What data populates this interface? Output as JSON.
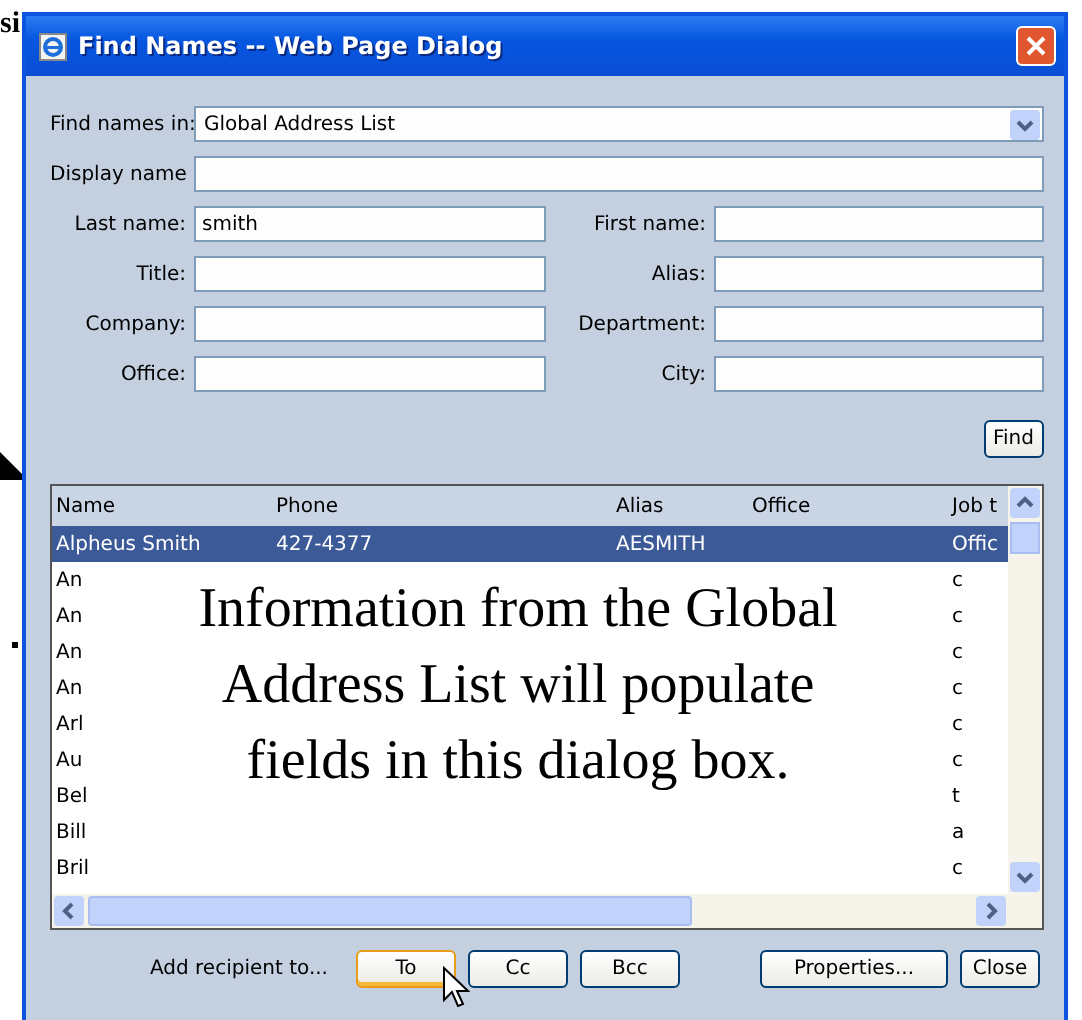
{
  "slide_text": "si",
  "window": {
    "title": "Find Names -- Web Page Dialog"
  },
  "find_in": {
    "label": "Find names in:",
    "value": "Global Address List"
  },
  "display_name": {
    "label": "Display name"
  },
  "fields": [
    {
      "label": "Last name:",
      "value": "smith"
    },
    {
      "label": "First name:"
    },
    {
      "label": "Title:"
    },
    {
      "label": "Alias:"
    },
    {
      "label": "Company:"
    },
    {
      "label": "Department:"
    },
    {
      "label": "Office:"
    },
    {
      "label": "City:"
    }
  ],
  "find_button": "Find",
  "table": {
    "columns": [
      "Name",
      "Phone",
      "Alias",
      "Office",
      "Job t"
    ],
    "rows": [
      {
        "cells": [
          "Alpheus Smith",
          "427-4377",
          "AESMITH",
          "",
          "Offic"
        ],
        "selected": true
      },
      {
        "cells": [
          "An",
          "",
          "",
          "",
          "c"
        ],
        "selected": false
      },
      {
        "cells": [
          "An",
          "",
          "",
          "",
          "c"
        ],
        "selected": false
      },
      {
        "cells": [
          "An",
          "",
          "",
          "",
          "c"
        ],
        "selected": false
      },
      {
        "cells": [
          "An",
          "",
          "",
          "",
          "c"
        ],
        "selected": false
      },
      {
        "cells": [
          "Arl",
          "",
          "",
          "",
          "c"
        ],
        "selected": false
      },
      {
        "cells": [
          "Au",
          "",
          "",
          "",
          "c"
        ],
        "selected": false
      },
      {
        "cells": [
          "Bel",
          "",
          "",
          "",
          "t"
        ],
        "selected": false
      },
      {
        "cells": [
          "Bill",
          "",
          "",
          "",
          "a"
        ],
        "selected": false
      },
      {
        "cells": [
          "Bril",
          "",
          "",
          "",
          "c"
        ],
        "selected": false
      }
    ]
  },
  "add_recipient_label": "Add recipient to...",
  "buttons": [
    {
      "label": "To",
      "focused": true
    },
    {
      "label": "Cc",
      "focused": false
    },
    {
      "label": "Bcc",
      "focused": false
    }
  ],
  "right_buttons": [
    "Properties...",
    "Close"
  ],
  "callout": "Information from the Global Address List will populate fields in this dialog box."
}
